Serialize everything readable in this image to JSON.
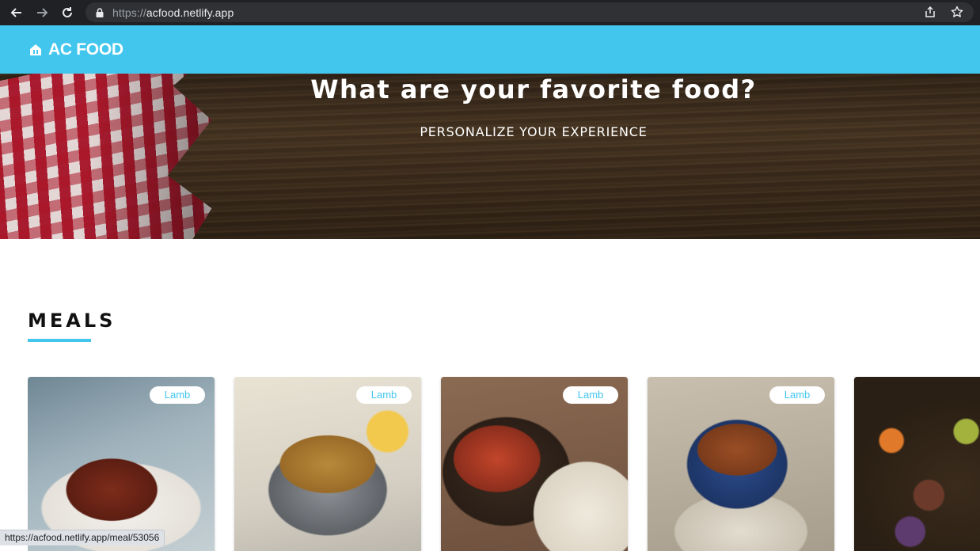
{
  "browser": {
    "url_scheme": "https://",
    "url_host": "acfood.netlify.app",
    "back_icon": "arrow-left",
    "forward_icon": "arrow-right",
    "reload_icon": "reload",
    "lock_icon": "lock",
    "share_icon": "share",
    "bookmark_icon": "star"
  },
  "header": {
    "brand": "AC FOOD",
    "brand_icon": "home-store",
    "background_color": "#42c6ee"
  },
  "hero": {
    "title": "What are your favorite food?",
    "subtitle": "PERSONALIZE YOUR EXPERIENCE"
  },
  "meals": {
    "section_title": "MEALS",
    "accent_color": "#42c6ee",
    "cards": [
      {
        "tag": "Lamb"
      },
      {
        "tag": "Lamb"
      },
      {
        "tag": "Lamb"
      },
      {
        "tag": "Lamb"
      },
      {
        "tag": ""
      }
    ]
  },
  "status_bar": {
    "link": "https://acfood.netlify.app/meal/53056"
  }
}
